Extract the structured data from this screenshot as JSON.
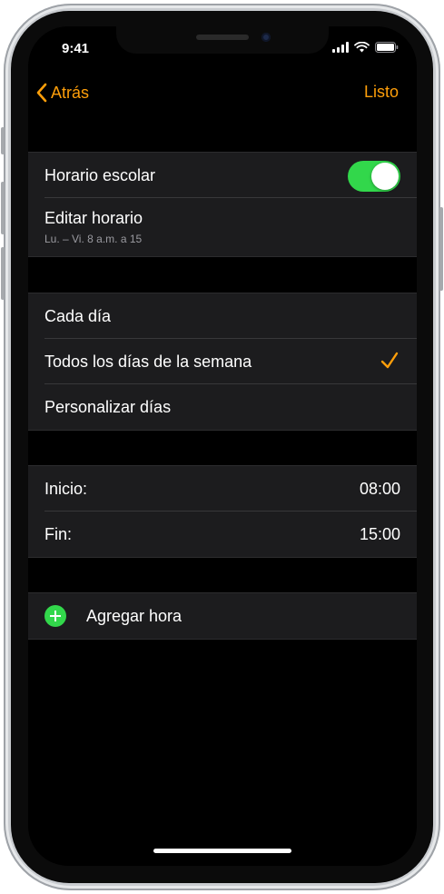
{
  "status": {
    "time": "9:41"
  },
  "nav": {
    "back_label": "Atrás",
    "done_label": "Listo"
  },
  "schedule": {
    "toggle_label": "Horario escolar",
    "toggle_on": true,
    "edit_label": "Editar horario",
    "edit_summary": "Lu. – Vi. 8 a.m. a 15"
  },
  "days": {
    "options": [
      "Cada día",
      "Todos los días de la semana",
      "Personalizar días"
    ],
    "selected_index": 1
  },
  "times": {
    "start_label": "Inicio:",
    "start_value": "08:00",
    "end_label": "Fin:",
    "end_value": "15:00"
  },
  "add": {
    "label": "Agregar hora"
  },
  "colors": {
    "accent": "#ff9f0a",
    "toggle_green": "#32d74b",
    "group_bg": "#1c1c1e"
  }
}
